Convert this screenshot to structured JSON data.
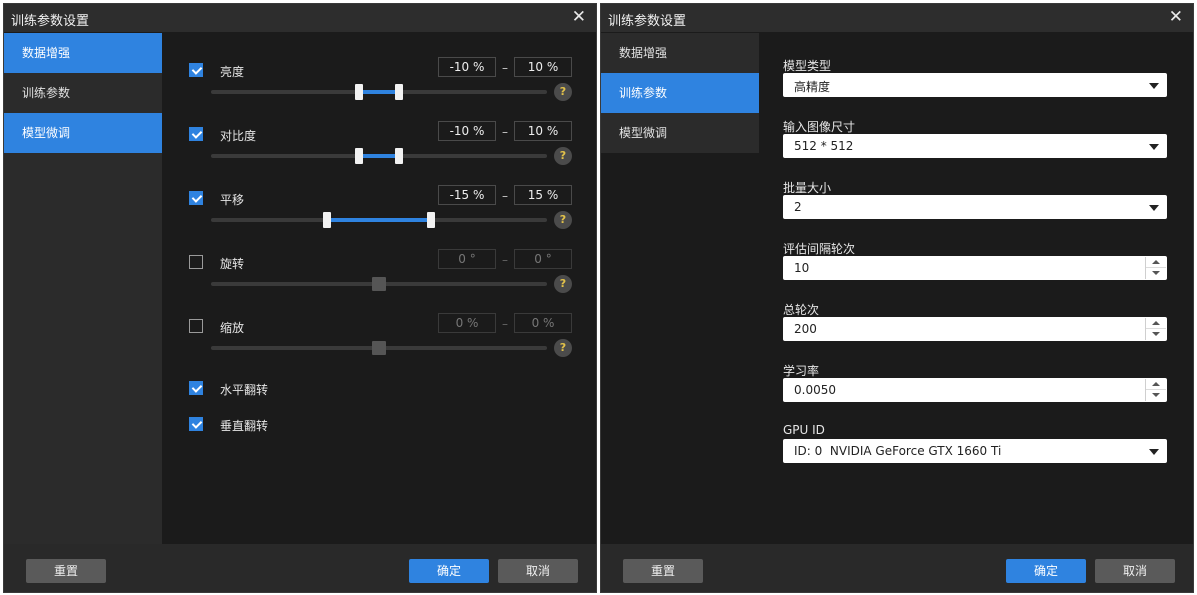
{
  "dialog_title": "训练参数设置",
  "close_symbol": "✕",
  "nav": [
    "数据增强",
    "训练参数",
    "模型微调"
  ],
  "buttons": {
    "reset": "重置",
    "ok": "确定",
    "cancel": "取消"
  },
  "augmentation": {
    "brightness": {
      "label": "亮度",
      "checked": true,
      "min": "-10 %",
      "max": "10 %"
    },
    "contrast": {
      "label": "对比度",
      "checked": true,
      "min": "-10 %",
      "max": "10 %"
    },
    "translate": {
      "label": "平移",
      "checked": true,
      "min": "-15 %",
      "max": "15 %"
    },
    "rotate": {
      "label": "旋转",
      "checked": false,
      "min": "0 °",
      "max": "0 °"
    },
    "scale": {
      "label": "缩放",
      "checked": false,
      "min": "0 %",
      "max": "0 %"
    },
    "hflip": {
      "label": "水平翻转",
      "checked": true
    },
    "vflip": {
      "label": "垂直翻转",
      "checked": true
    },
    "help_symbol": "?"
  },
  "params": {
    "model_type": {
      "label": "模型类型",
      "value": "高精度"
    },
    "input_size": {
      "label": "输入图像尺寸",
      "value": "512 * 512"
    },
    "batch_size": {
      "label": "批量大小",
      "value": "2"
    },
    "eval_interval": {
      "label": "评估间隔轮次",
      "value": "10"
    },
    "total_epochs": {
      "label": "总轮次",
      "value": "200"
    },
    "learning_rate": {
      "label": "学习率",
      "value": "0.0050"
    },
    "gpu": {
      "label": "GPU ID",
      "value": "ID: 0  NVIDIA GeForce GTX 1660 Ti"
    }
  },
  "colors": {
    "accent": "#2f83e0",
    "background": "#1b1b1b",
    "sidebar": "#2b2b2b"
  }
}
